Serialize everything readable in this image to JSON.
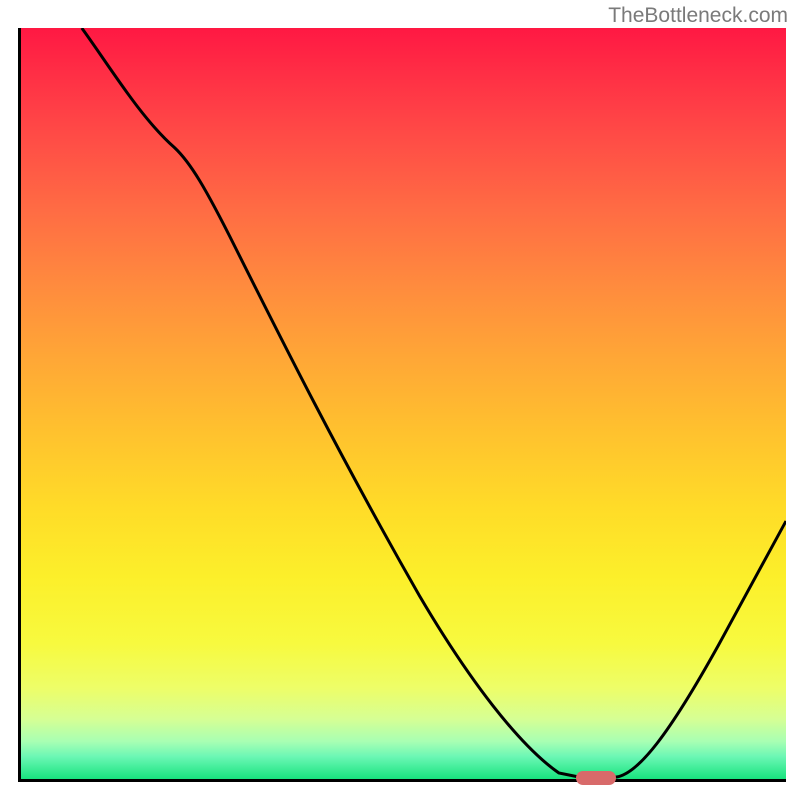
{
  "watermark": "TheBottleneck.com",
  "chart_data": {
    "type": "line",
    "title": "",
    "xlabel": "",
    "ylabel": "",
    "xlim": [
      0,
      100
    ],
    "ylim": [
      0,
      100
    ],
    "grid": false,
    "legend": false,
    "curve": {
      "description": "Bottleneck curve descending from top-left, reaching a minimum plateau near x≈73-78, then rising toward the right edge.",
      "x": [
        8,
        13,
        20,
        25,
        30,
        35,
        40,
        45,
        50,
        55,
        60,
        65,
        68,
        71,
        73,
        76,
        78,
        82,
        88,
        94,
        100
      ],
      "y": [
        100,
        94,
        84,
        78,
        67,
        58,
        49,
        40,
        31,
        23,
        15,
        8,
        4,
        1,
        0,
        0,
        1,
        6,
        15,
        24,
        34
      ]
    },
    "background_gradient": {
      "top": "#ff1843",
      "middle": "#ffdc28",
      "bottom": "#18e37e"
    },
    "marker": {
      "shape": "rounded-rect",
      "color": "#d86a6a",
      "x_center_pct": 75,
      "y_pct": 0
    }
  }
}
